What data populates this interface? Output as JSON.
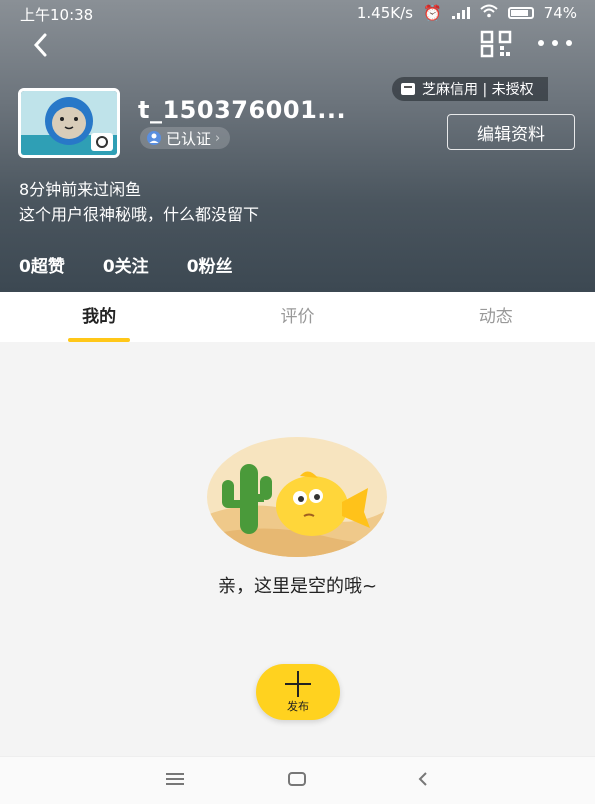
{
  "status_bar": {
    "time": "上午10:38",
    "net_speed": "1.45K/s",
    "battery": "74%"
  },
  "header": {
    "icons": [
      "back-arrow",
      "qr-code",
      "more-dots"
    ],
    "username": "t_150376001...",
    "verified": "已认证",
    "credit": "芝麻信用 | 未授权",
    "edit_profile": "编辑资料",
    "last_visit": "8分钟前来过闲鱼",
    "bio": "这个用户很神秘哦，什么都没留下",
    "stats": {
      "likes": "0超赞",
      "following": "0关注",
      "followers": "0粉丝"
    }
  },
  "tabs": [
    {
      "label": "我的",
      "active": true
    },
    {
      "label": "评价",
      "active": false
    },
    {
      "label": "动态",
      "active": false
    }
  ],
  "empty_state": {
    "message": "亲，这里是空的哦~"
  },
  "publish": {
    "label": "发布"
  },
  "nav_bar": {
    "icons": [
      "menu",
      "home",
      "back"
    ]
  },
  "colors": {
    "accent": "#ffc718",
    "publish_button": "#ffd21f",
    "header_top": "#8a9096",
    "header_bottom": "#3c4852"
  }
}
